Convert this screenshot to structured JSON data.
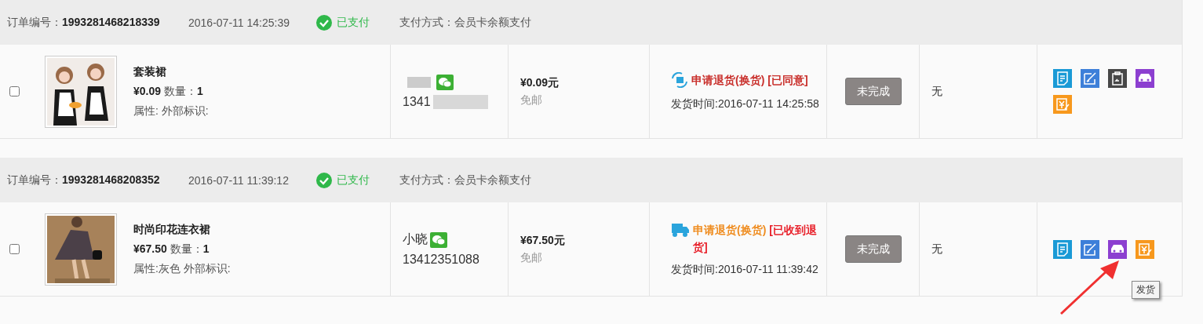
{
  "orders": [
    {
      "order_label": "订单编号：",
      "order_no": "1993281468218339",
      "time": "2016-07-11 14:25:39",
      "paid": true,
      "paid_label": "已支付",
      "payment": "支付方式：会员卡余额支付",
      "checked": false,
      "image": {
        "kind": "picture"
      },
      "product": "套装裙",
      "price": "¥0.09",
      "qty_label": "数量：",
      "qty": "1",
      "attrs": "属性: 外部标识:",
      "buyer_blurred": true,
      "phone": "1341",
      "total": "¥0.09元",
      "shipping": "免邮",
      "status": {
        "kind": "exchange",
        "parts": [
          {
            "text": "申请退货(换货)",
            "color": "#c9302c"
          },
          {
            "text": "[已同意]",
            "color": "#c9302c"
          }
        ]
      },
      "ship_time": "发货时间:2016-07-11 14:25:58",
      "button": "未完成",
      "remark": "无",
      "actions": [
        {
          "kind": "doc",
          "color": "#1a9ad6"
        },
        {
          "kind": "edit",
          "color": "#3d7fd9"
        },
        {
          "kind": "clipboard",
          "color": "#474747"
        },
        {
          "kind": "car",
          "color": "#8c3fd0"
        },
        {
          "kind": "yen",
          "color": "#f7981d"
        }
      ]
    },
    {
      "order_label": "订单编号：",
      "order_no": "1993281468208352",
      "time": "2016-07-11 11:39:12",
      "paid": true,
      "paid_label": "已支付",
      "payment": "支付方式：会员卡余额支付",
      "checked": false,
      "image": {
        "kind": "picture"
      },
      "product": "时尚印花连衣裙",
      "price": "¥67.50",
      "qty_label": "数量：",
      "qty": "1",
      "attrs": "属性:灰色 外部标识:",
      "buyer": "小晓",
      "buyer_blurred": false,
      "phone": "13412351088",
      "total": "¥67.50元",
      "shipping": "免邮",
      "status": {
        "kind": "truck",
        "parts": [
          {
            "text": "申请退货(换货)",
            "color": "#ef8c1f"
          },
          {
            "text": "[已收到退货]",
            "color": "#e8202a"
          }
        ]
      },
      "ship_time": "发货时间:2016-07-11 11:39:42",
      "button": "未完成",
      "remark": "无",
      "actions": [
        {
          "kind": "doc",
          "color": "#1a9ad6"
        },
        {
          "kind": "edit",
          "color": "#3d7fd9"
        },
        {
          "kind": "car",
          "color": "#8c3fd0"
        },
        {
          "kind": "yen",
          "color": "#f7981d"
        }
      ],
      "tooltip": "发货"
    }
  ]
}
